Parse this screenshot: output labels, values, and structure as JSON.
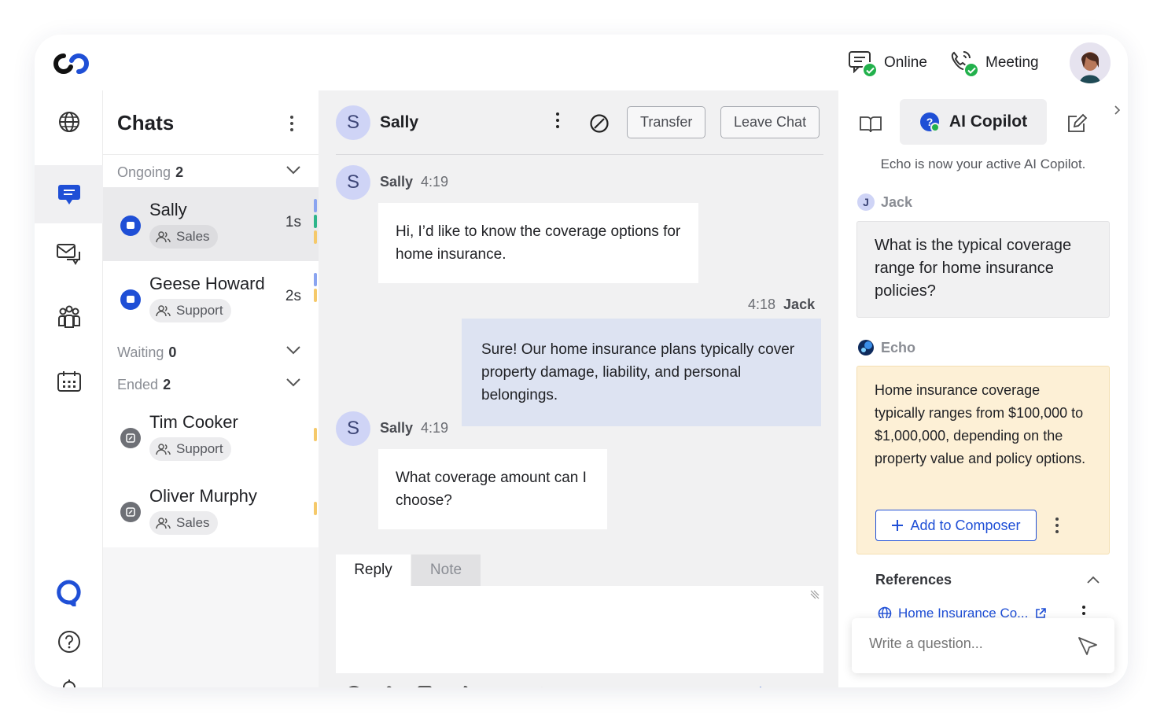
{
  "topbar": {
    "online_label": "Online",
    "meeting_label": "Meeting"
  },
  "chats": {
    "title": "Chats",
    "ongoing": {
      "label": "Ongoing",
      "count": "2"
    },
    "waiting": {
      "label": "Waiting",
      "count": "0"
    },
    "ended": {
      "label": "Ended",
      "count": "2"
    },
    "items": [
      {
        "name": "Sally",
        "tag": "Sales",
        "time": "1s"
      },
      {
        "name": "Geese Howard",
        "tag": "Support",
        "time": "2s"
      },
      {
        "name": "Tim Cooker",
        "tag": "Support",
        "time": ""
      },
      {
        "name": "Oliver Murphy",
        "tag": "Sales",
        "time": ""
      }
    ]
  },
  "conversation": {
    "contact_initial": "S",
    "contact_name": "Sally",
    "transfer_label": "Transfer",
    "leave_label": "Leave Chat",
    "messages": [
      {
        "initial": "S",
        "sender": "Sally",
        "time": "4:19",
        "text": "Hi, I’d like to know the coverage options for home insurance."
      },
      {
        "sender": "Jack",
        "time": "4:18",
        "text": "Sure! Our home insurance plans typically cover property damage, liability, and personal belongings."
      },
      {
        "initial": "S",
        "sender": "Sally",
        "time": "4:19",
        "text": "What coverage amount can I choose?"
      }
    ],
    "reply_tab": "Reply",
    "note_tab": "Note"
  },
  "copilot": {
    "tab_label": "AI Copilot",
    "notice": "Echo is now your active AI Copilot.",
    "question_author_initial": "J",
    "question_author": "Jack",
    "question": "What is the typical coverage range for home insurance policies?",
    "answer_author": "Echo",
    "answer": "Home insurance coverage typically ranges from $100,000 to $1,000,000, depending on the property value and policy options.",
    "add_button": "Add to Composer",
    "references_label": "References",
    "reference_link": "Home Insurance Co...",
    "ask_placeholder": "Write a question..."
  },
  "colors": {
    "accent": "#1f4fd6",
    "online_green": "#22b14c",
    "answer_bg": "#fdf0d6",
    "agent_bubble": "#dde3f2"
  }
}
